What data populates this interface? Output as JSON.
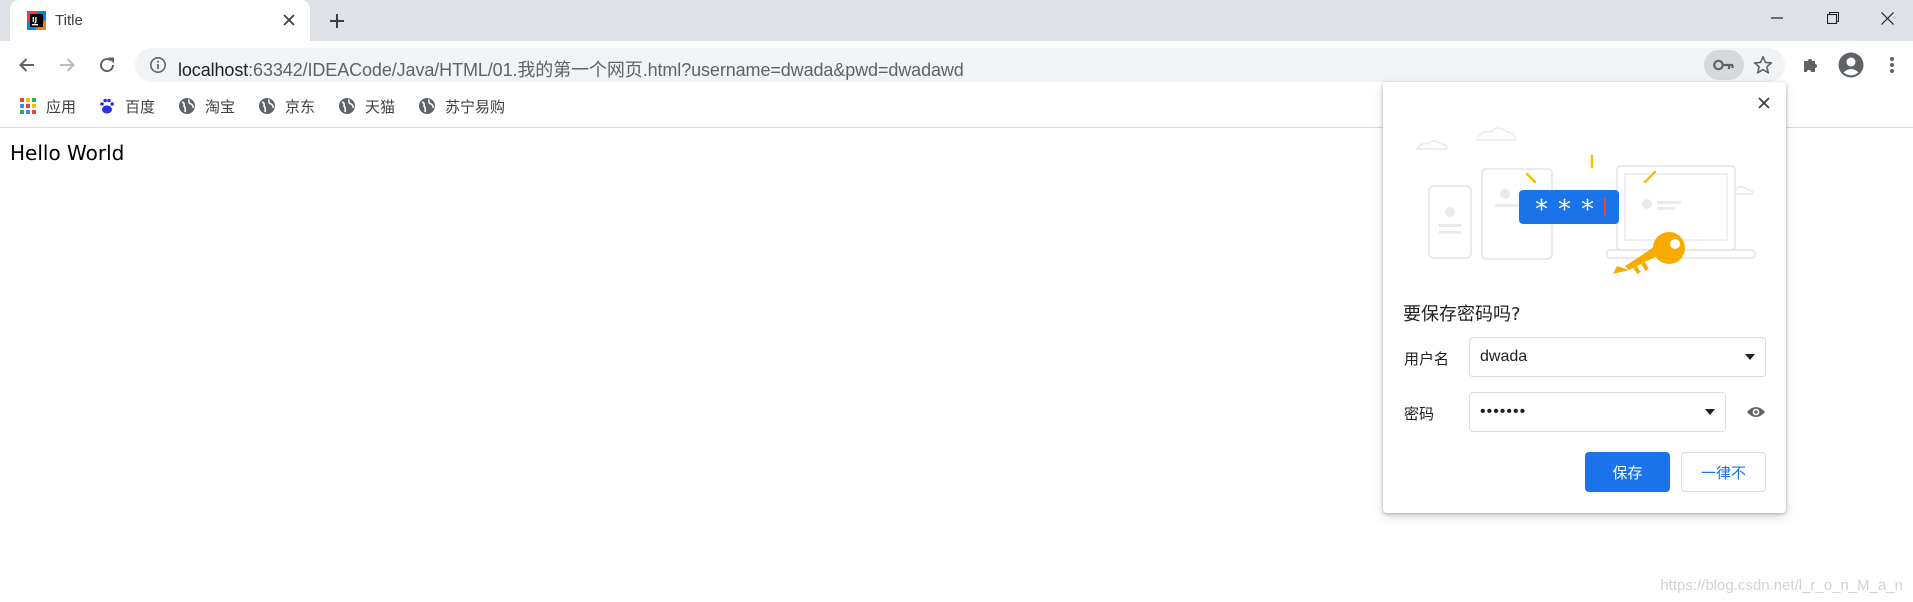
{
  "tab": {
    "title": "Title"
  },
  "toolbar": {
    "url_host": "localhost",
    "url_rest": ":63342/IDEACode/Java/HTML/01.我的第一个网页.html?username=dwada&pwd=dwadawd"
  },
  "bookmarks": [
    {
      "label": "应用",
      "icon": "apps-grid-icon"
    },
    {
      "label": "百度",
      "icon": "baidu-paw-icon"
    },
    {
      "label": "淘宝",
      "icon": "globe-icon"
    },
    {
      "label": "京东",
      "icon": "globe-icon"
    },
    {
      "label": "天猫",
      "icon": "globe-icon"
    },
    {
      "label": "苏宁易购",
      "icon": "globe-icon"
    }
  ],
  "page": {
    "text": "Hello World"
  },
  "save_password": {
    "title": "要保存密码吗?",
    "username_label": "用户名",
    "username_value": "dwada",
    "password_label": "密码",
    "password_value": "•••••••",
    "save_label": "保存",
    "never_label": "一律不"
  },
  "watermark": "https://blog.csdn.net/l_r_o_n_M_a_n",
  "colors": {
    "accent": "#1a73e8",
    "tabstrip": "#dee1e6",
    "key_gold": "#f9ab00"
  }
}
